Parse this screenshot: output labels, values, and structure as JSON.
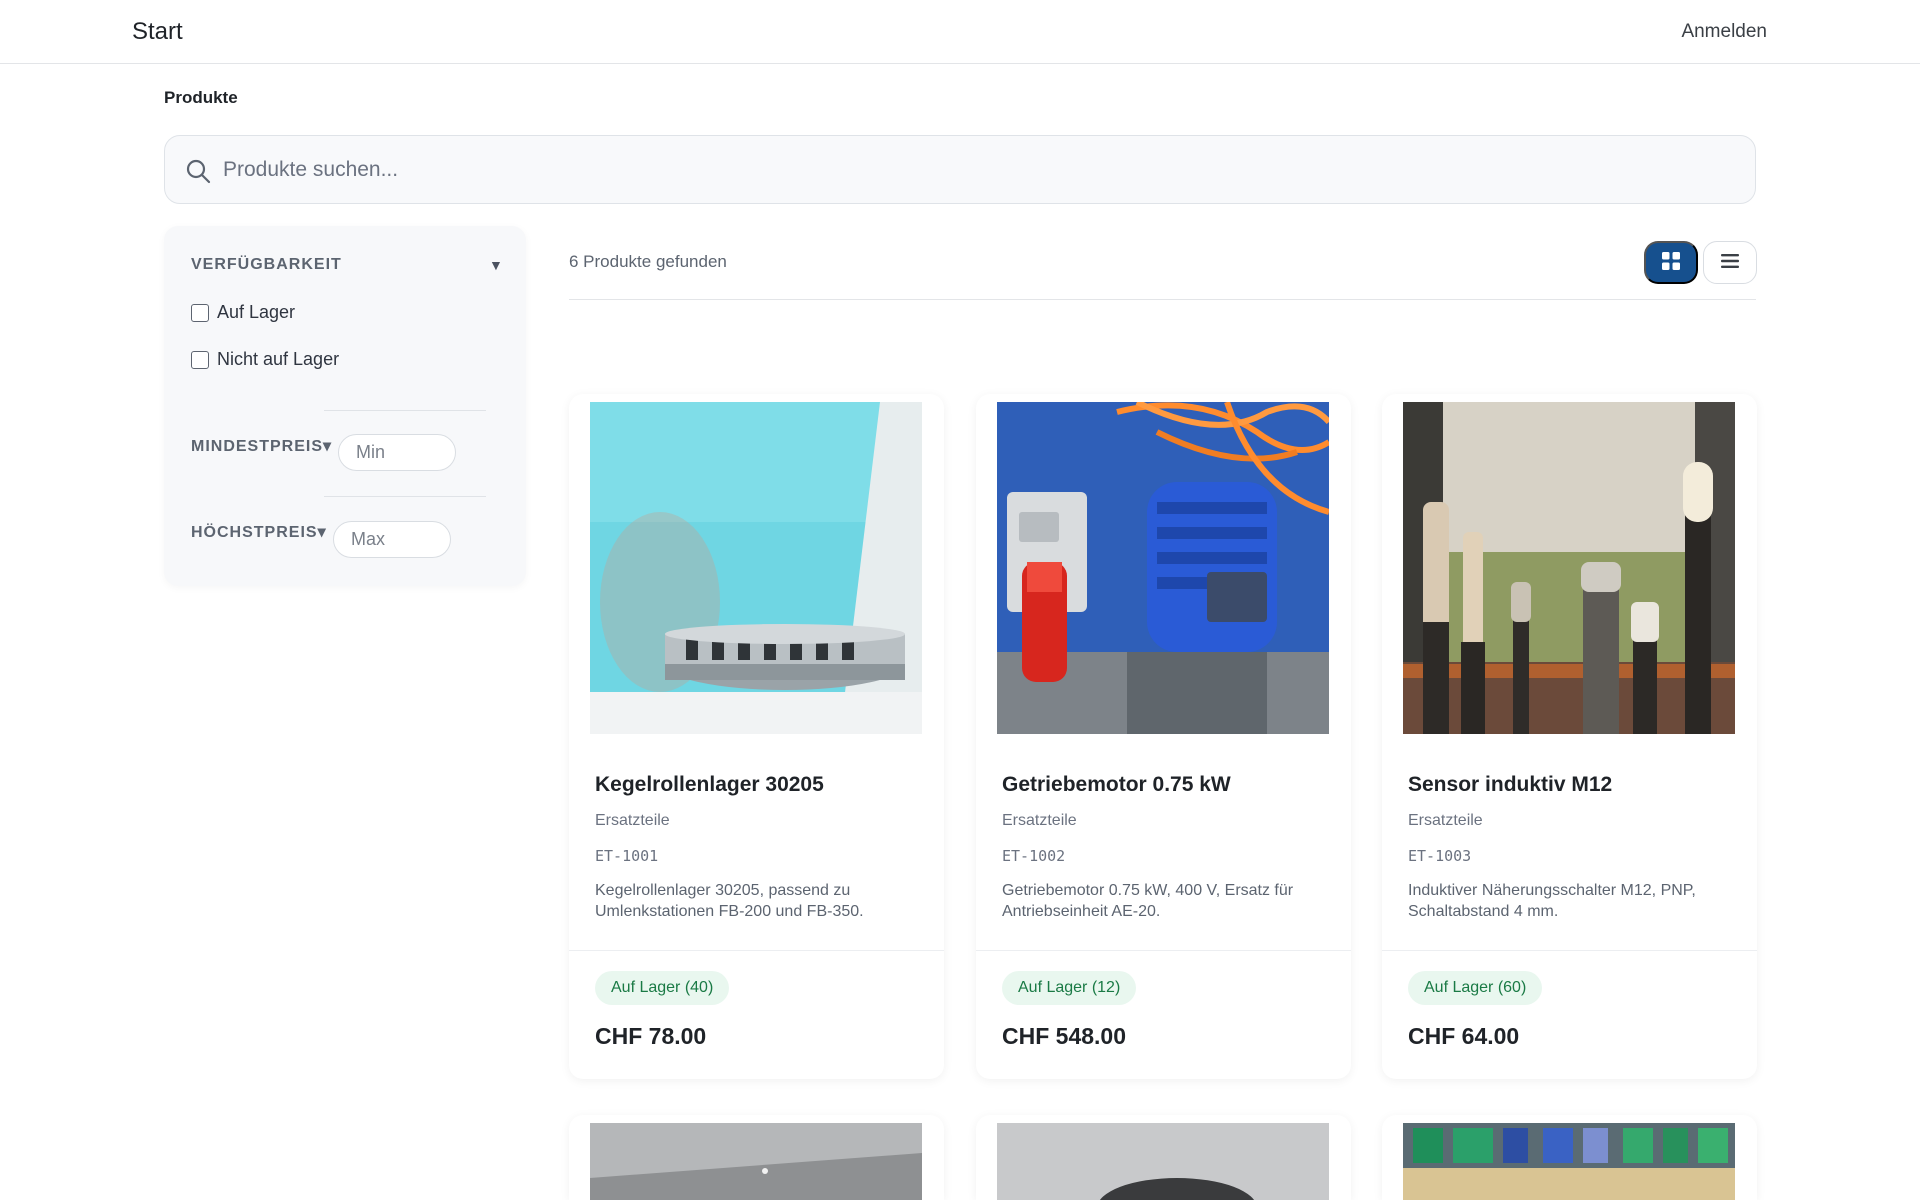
{
  "nav": {
    "brand": "Start",
    "login": "Anmelden"
  },
  "breadcrumb": "Produkte",
  "search": {
    "placeholder": "Produkte suchen..."
  },
  "filters": {
    "availability": {
      "heading": "VERFÜGBARKEIT",
      "options": [
        "Auf Lager",
        "Nicht auf Lager"
      ]
    },
    "min_price": {
      "heading": "MINDESTPREIS",
      "placeholder": "Min"
    },
    "max_price": {
      "heading": "HÖCHSTPREIS",
      "placeholder": "Max"
    }
  },
  "results": {
    "count_text": "6 Produkte gefunden",
    "view_mode": "grid"
  },
  "products": [
    {
      "name": "Kegelrollenlager 30205",
      "category": "Ersatzteile",
      "sku": "ET-1001",
      "description": "Kegelrollenlager 30205, passend zu Umlenkstationen FB-200 und FB-350.",
      "stock": "Auf Lager (40)",
      "price": "CHF 78.00"
    },
    {
      "name": "Getriebemotor 0.75 kW",
      "category": "Ersatzteile",
      "sku": "ET-1002",
      "description": "Getriebemotor 0.75 kW, 400 V, Ersatz für Antriebseinheit AE-20.",
      "stock": "Auf Lager (12)",
      "price": "CHF 548.00"
    },
    {
      "name": "Sensor induktiv M12",
      "category": "Ersatzteile",
      "sku": "ET-1003",
      "description": "Induktiver Näherungsschalter M12, PNP, Schaltabstand 4 mm.",
      "stock": "Auf Lager (60)",
      "price": "CHF 64.00"
    }
  ],
  "colors": {
    "accent": "#16508e",
    "stock_bg": "#e9f7ef",
    "stock_text": "#1a7a45"
  }
}
